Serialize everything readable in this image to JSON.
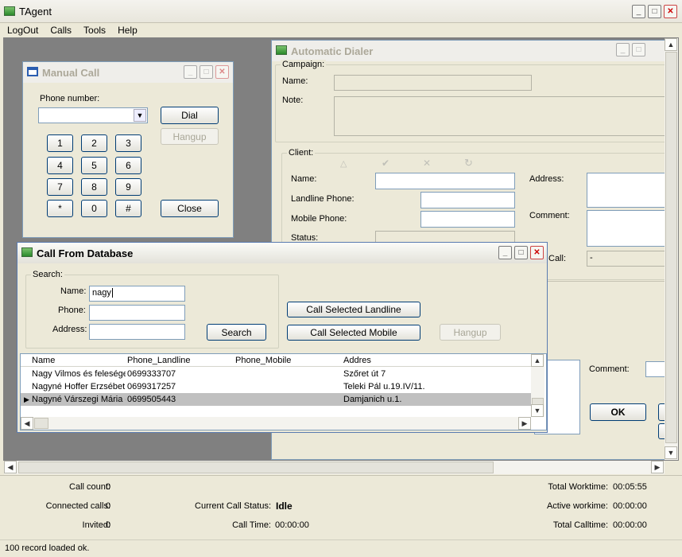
{
  "app": {
    "title": "TAgent"
  },
  "menu": [
    "LogOut",
    "Calls",
    "Tools",
    "Help"
  ],
  "manual_call": {
    "title": "Manual Call",
    "phone_label": "Phone number:",
    "dial": "Dial",
    "hangup": "Hangup",
    "close": "Close",
    "keys": [
      "1",
      "2",
      "3",
      "4",
      "5",
      "6",
      "7",
      "8",
      "9",
      "*",
      "0",
      "#"
    ]
  },
  "dialer": {
    "title": "Automatic Dialer",
    "campaign_label": "Campaign:",
    "name_label": "Name:",
    "note_label": "Note:",
    "client_label": "Client:",
    "client_name": "Name:",
    "landline": "Landline Phone:",
    "mobile": "Mobile Phone:",
    "status": "Status:",
    "address": "Address:",
    "comment": "Comment:",
    "call_partial": "Call:",
    "call_value": "-",
    "comment2": "Comment:",
    "ok": "OK"
  },
  "db": {
    "title": "Call From Database",
    "search_label": "Search:",
    "name_label": "Name:",
    "name_value": "nagy",
    "phone_label": "Phone:",
    "address_label": "Address:",
    "search_btn": "Search",
    "call_landline": "Call Selected Landline",
    "call_mobile": "Call Selected Mobile",
    "hangup": "Hangup",
    "columns": [
      "Name",
      "Phone_Landline",
      "Phone_Mobile",
      "Addres"
    ],
    "rows": [
      {
        "name": "Nagy Vilmos és felesége",
        "landline": "0699333707",
        "mobile": "",
        "address": "Szőret út 7",
        "selected": false
      },
      {
        "name": "Nagyné Hoffer Erzsébet és",
        "landline": "0699317257",
        "mobile": "",
        "address": "Teleki Pál u.19.IV/11.",
        "selected": false
      },
      {
        "name": "Nagyné Várszegi Mária ész",
        "landline": "0699505443",
        "mobile": "",
        "address": "Damjanich u.1.",
        "selected": true
      }
    ]
  },
  "stats": {
    "call_count_label": "Call count:",
    "call_count": "0",
    "connected_label": "Connected calls:",
    "connected": "0",
    "invited_label": "Invited:",
    "invited": "0",
    "status_label": "Current Call Status:",
    "status": "Idle",
    "calltime_label": "Call Time:",
    "calltime": "00:00:00",
    "total_work_label": "Total Worktime:",
    "total_work": "00:05:55",
    "active_work_label": "Active workime:",
    "active_work": "00:00:00",
    "total_call_label": "Total Calltime:",
    "total_call": "00:00:00"
  },
  "statusbar": "100 record loaded ok."
}
